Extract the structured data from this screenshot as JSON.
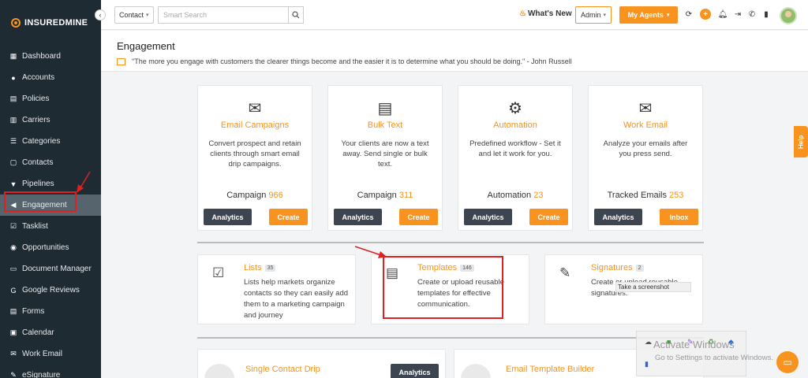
{
  "app": {
    "logo_text": "INSUREDMINE"
  },
  "sidebar": {
    "items": [
      {
        "label": "Dashboard",
        "icon": "dashboard-icon"
      },
      {
        "label": "Accounts",
        "icon": "accounts-icon"
      },
      {
        "label": "Policies",
        "icon": "policies-icon"
      },
      {
        "label": "Carriers",
        "icon": "carriers-icon"
      },
      {
        "label": "Categories",
        "icon": "categories-icon"
      },
      {
        "label": "Contacts",
        "icon": "contacts-icon"
      },
      {
        "label": "Pipelines",
        "icon": "pipelines-icon"
      },
      {
        "label": "Engagement",
        "icon": "megaphone-icon",
        "active": true
      },
      {
        "label": "Tasklist",
        "icon": "tasklist-icon"
      },
      {
        "label": "Opportunities",
        "icon": "opportunities-icon"
      },
      {
        "label": "Document Manager",
        "icon": "folder-icon"
      },
      {
        "label": "Google Reviews",
        "icon": "google-icon"
      },
      {
        "label": "Forms",
        "icon": "forms-icon"
      },
      {
        "label": "Calendar",
        "icon": "calendar-icon"
      },
      {
        "label": "Work Email",
        "icon": "email-icon"
      },
      {
        "label": "eSignature",
        "icon": "signature-icon"
      }
    ]
  },
  "topbar": {
    "contact_select": "Contact",
    "search_placeholder": "Smart Search",
    "whats_new": "What's New",
    "admin_select": "Admin",
    "my_agents": "My Agents"
  },
  "header": {
    "title": "Engagement",
    "quote": "\"The more you engage with customers the clearer things become and the easier it is to determine what you should be doing.\" - John Russell"
  },
  "big_cards": [
    {
      "title": "Email Campaigns",
      "desc": "Convert prospect and retain clients through smart email drip campaigns.",
      "stat_label": "Campaign",
      "stat_value": "966",
      "btn_left": "Analytics",
      "btn_right": "Create",
      "icon": "email-campaign-icon"
    },
    {
      "title": "Bulk Text",
      "desc": "Your clients are now a text away. Send single or bulk text.",
      "stat_label": "Campaign",
      "stat_value": "311",
      "btn_left": "Analytics",
      "btn_right": "Create",
      "icon": "chat-bubble-icon"
    },
    {
      "title": "Automation",
      "desc": "Predefined workflow - Set it and let it work for you.",
      "stat_label": "Automation",
      "stat_value": "23",
      "btn_left": "Analytics",
      "btn_right": "Create",
      "icon": "workflow-icon"
    },
    {
      "title": "Work Email",
      "desc": "Analyze your emails after you press send.",
      "stat_label": "Tracked Emails",
      "stat_value": "253",
      "btn_left": "Analytics",
      "btn_right": "Inbox",
      "icon": "work-email-icon"
    }
  ],
  "mid_cards": [
    {
      "title": "Lists",
      "badge": "35",
      "desc": "Lists help markets organize contacts so they can easily add them to a marketing campaign and journey",
      "icon": "checklist-icon"
    },
    {
      "title": "Templates",
      "badge": "146",
      "desc": "Create or upload reusable templates for effective communication.",
      "icon": "template-icon"
    },
    {
      "title": "Signatures",
      "badge": "2",
      "desc": "Create or upload reusable signatures.",
      "icon": "signature-doc-icon"
    }
  ],
  "bottom_cards": [
    {
      "title": "Single Contact Drip",
      "button": "Analytics"
    },
    {
      "title": "Email Template Builder"
    }
  ],
  "tooltip": "Take a screenshot",
  "help_tab": "Help",
  "windows_overlay": {
    "title": "Activate Windows",
    "subtitle": "Go to Settings to activate Windows."
  }
}
